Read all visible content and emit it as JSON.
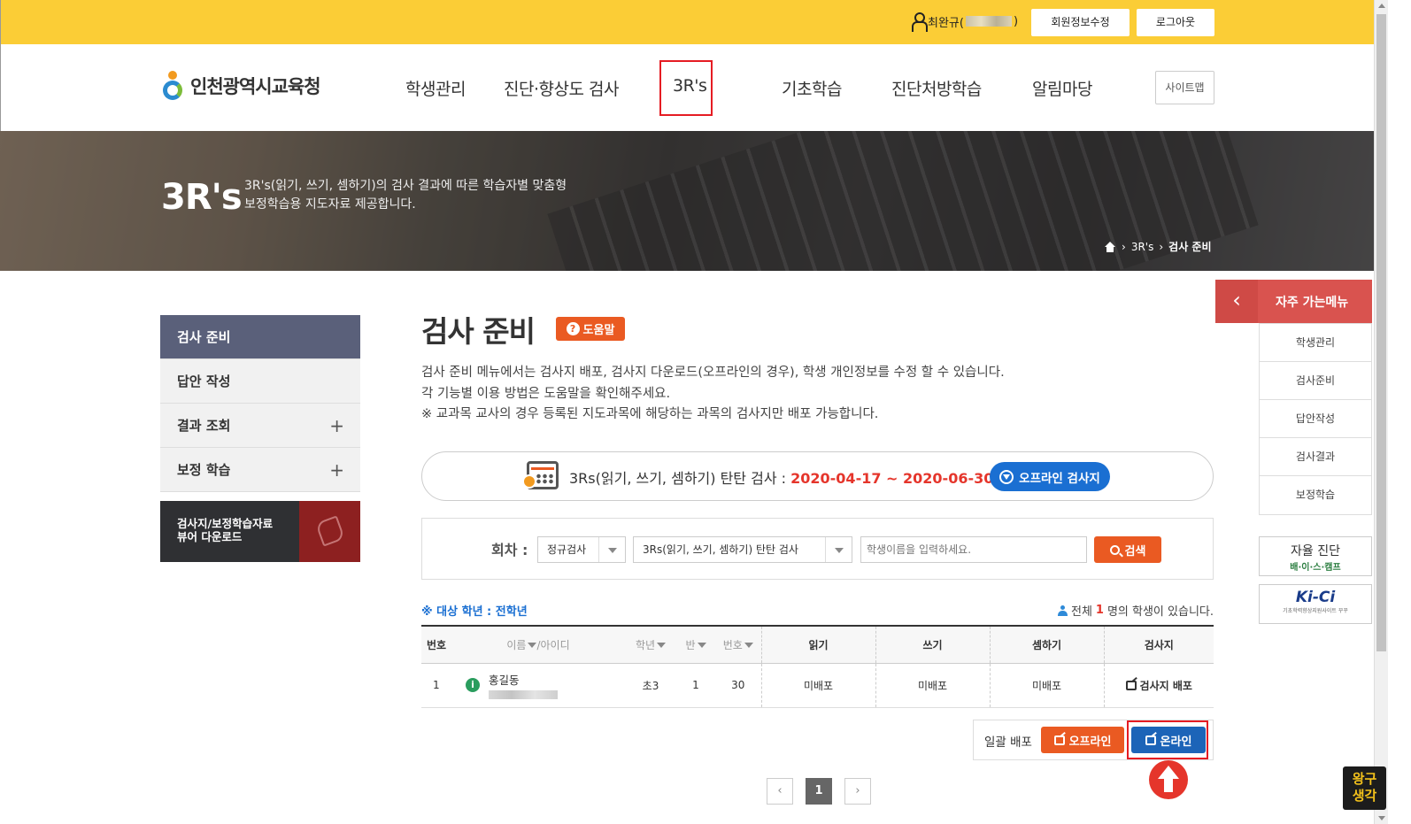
{
  "topbar": {
    "user_name": "최완규(",
    "user_name_close": ")",
    "member_edit": "회원정보수정",
    "logout": "로그아웃"
  },
  "header": {
    "logo": "인천광역시교육청",
    "nav": [
      "학생관리",
      "진단·향상도 검사",
      "3R's",
      "기초학습",
      "진단처방학습",
      "알림마당"
    ],
    "sitemap": "사이트맵"
  },
  "banner": {
    "title": "3R's",
    "desc_line1": "3R's(읽기, 쓰기, 셈하기)의 검사 결과에 따른 학습자별 맞춤형",
    "desc_line2": "보정학습용 지도자료 제공합니다.",
    "breadcrumb": [
      "3R's",
      "검사 준비"
    ]
  },
  "sidebar": {
    "items": [
      "검사 준비",
      "답안 작성",
      "결과 조회",
      "보정 학습"
    ],
    "download_line1": "검사지/보정학습자료",
    "download_line2": "뷰어 다운로드"
  },
  "main": {
    "title": "검사 준비",
    "help": "도움말",
    "desc1": "검사 준비 메뉴에서는 검사지 배포, 검사지 다운로드(오프라인의 경우), 학생 개인정보를 수정 할 수 있습니다.",
    "desc2": "각 기능별 이용 방법은 도움말을 확인해주세요.",
    "desc3": "※ 교과목 교사의 경우 등록된 지도과목에 해당하는 과목의 검사지만 배포 가능합니다.",
    "exam_name": "3Rs(읽기, 쓰기, 셈하기) 탄탄 검사 : ",
    "exam_period": "2020-04-17 ~ 2020-06-30",
    "offline_sheet": "오프라인 검사지"
  },
  "search": {
    "label": "회차 :",
    "round": "정규검사",
    "exam": "3Rs(읽기, 쓰기, 셈하기) 탄탄 검사",
    "placeholder": "학생이름을 입력하세요.",
    "button": "검색"
  },
  "list": {
    "target_grade": "※ 대상 학년 : 전학년",
    "total_prefix": "전체 ",
    "total_count": "1",
    "total_suffix": "명의 학생이 있습니다.",
    "headers": {
      "no": "번호",
      "name": "이름",
      "id": "/아이디",
      "grade": "학년",
      "class": "반",
      "number": "번호",
      "reading": "읽기",
      "writing": "쓰기",
      "math": "셈하기",
      "sheet": "검사지"
    },
    "rows": [
      {
        "no": "1",
        "name": "홍길동",
        "grade": "초3",
        "class": "1",
        "number": "30",
        "reading": "미배포",
        "writing": "미배포",
        "math": "미배포",
        "sheet": "검사지 배포"
      }
    ]
  },
  "bulk": {
    "label": "일괄 배포",
    "offline": "오프라인",
    "online": "온라인"
  },
  "pagination": {
    "current": "1"
  },
  "quick": {
    "title": "자주 가는메뉴",
    "items": [
      "학생관리",
      "검사준비",
      "답안작성",
      "검사결과",
      "보정학습"
    ],
    "self_diag": "자율 진단",
    "self_diag_sub": "배·이·스·캠프",
    "kici": "Ki-Ci",
    "kici_sub": "기초학력향상지원사이트 꾸꾸"
  },
  "watermark": {
    "line1": "왕구",
    "line2": "생각"
  },
  "colors": {
    "topbar": "#fbcd36",
    "accent": "#ea5a22",
    "primary": "#1a6fd2",
    "highlight": "#e51c23"
  }
}
